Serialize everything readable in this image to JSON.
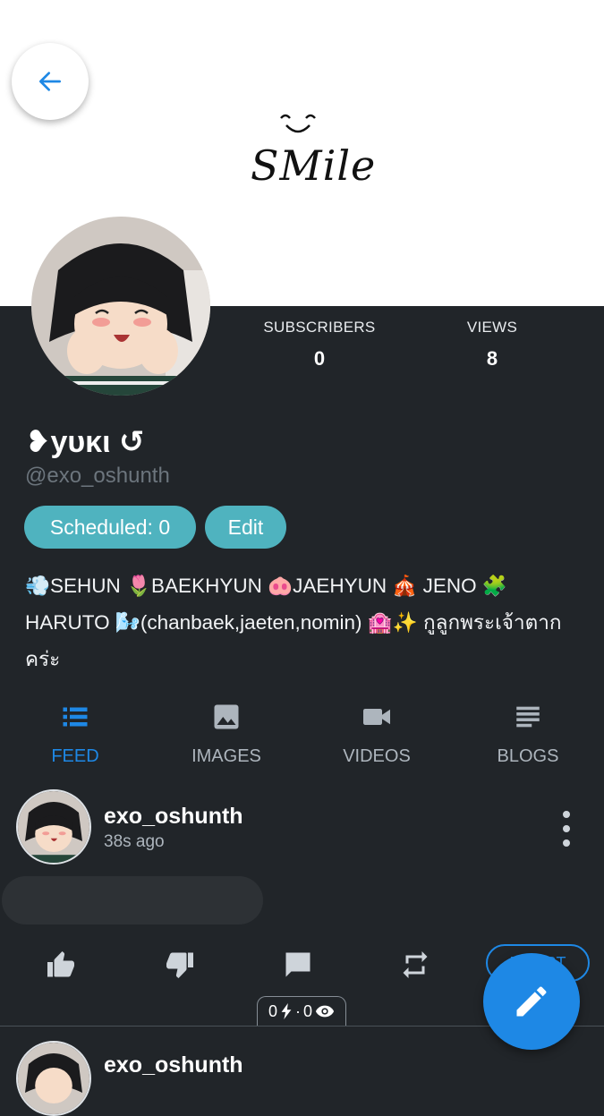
{
  "banner": {
    "art_text": "SMile"
  },
  "profile": {
    "display_name": "❥yᴜᴋι ↺",
    "handle": "@exo_oshunth",
    "stats": [
      {
        "label": "SUBSCRIBERS",
        "value": "0"
      },
      {
        "label": "VIEWS",
        "value": "8"
      }
    ],
    "scheduled_label": "Scheduled: 0",
    "edit_label": "Edit",
    "bio": "💨SEHUN 🌷BAEKHYUN 🐽JAEHYUN 🎪 JENO 🧩 HARUTO 🌬️(chanbaek,jaeten,nomin) 🏩✨ กูลูกพระเจ้าตากคร่ะ"
  },
  "tabs": [
    {
      "label": "FEED",
      "icon": "feed-list-icon",
      "active": true
    },
    {
      "label": "IMAGES",
      "icon": "image-icon",
      "active": false
    },
    {
      "label": "VIDEOS",
      "icon": "video-camera-icon",
      "active": false
    },
    {
      "label": "BLOGS",
      "icon": "blog-lines-icon",
      "active": false
    }
  ],
  "post": {
    "author": "exo_oshunth",
    "time": "38s ago",
    "boost_label": "BOOST",
    "counter_left": "0",
    "counter_right": "0"
  },
  "post2": {
    "author": "exo_oshunth"
  },
  "colors": {
    "accent": "#1e88e5",
    "teal": "#4fb3bf",
    "background": "#212529"
  }
}
